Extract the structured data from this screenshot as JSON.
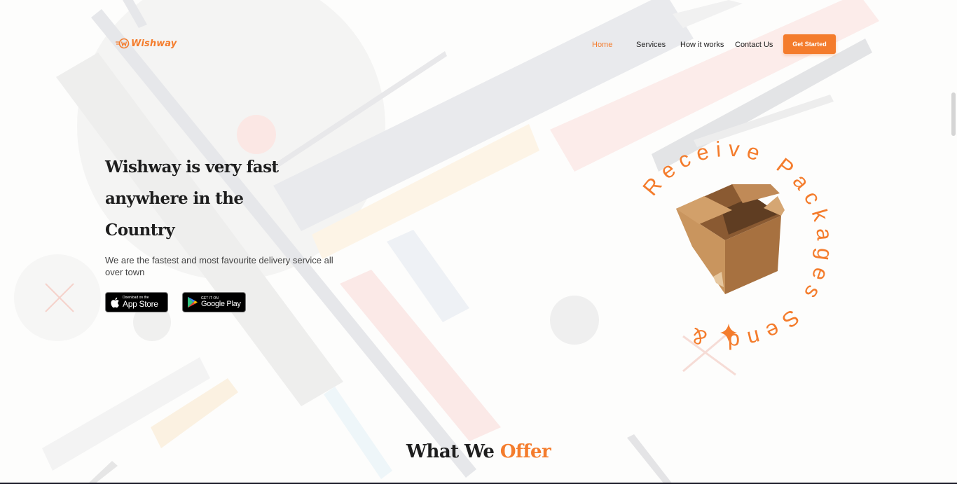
{
  "brand": {
    "name": "Wishway",
    "accent_color": "#f47c2c"
  },
  "nav": {
    "items": [
      {
        "label": "Home",
        "active": true
      },
      {
        "label": "Services",
        "active": false
      },
      {
        "label": "How it works",
        "active": false
      },
      {
        "label": "Contact Us",
        "active": false
      }
    ],
    "cta_label": "Get Started"
  },
  "hero": {
    "title_line1": "Wishway is very fast",
    "title_line2": "anywhere in the",
    "title_line3": "Country",
    "subtitle": "We are the fastest and most favourite delivery service all over town",
    "app_store": {
      "small": "Download on the",
      "big": "App Store",
      "icon": "apple-icon"
    },
    "google_play": {
      "small": "GET IT ON",
      "big": "Google Play",
      "icon": "google-play-icon"
    }
  },
  "badge": {
    "ring_text": "Receive Packages Send &",
    "icon": "open-box-icon"
  },
  "section": {
    "title_plain": "What We ",
    "title_accent": "Offer"
  }
}
